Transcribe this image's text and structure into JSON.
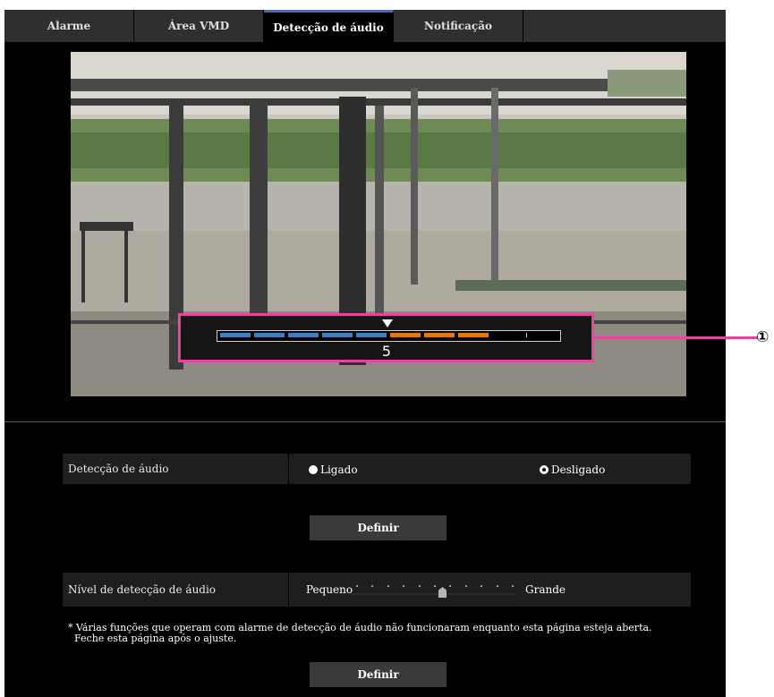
{
  "tabs": [
    {
      "label": "Alarme",
      "active": false
    },
    {
      "label": "Área VMD",
      "active": false
    },
    {
      "label": "Detecção de áudio",
      "active": true
    },
    {
      "label": "Notificação",
      "active": false
    }
  ],
  "meter": {
    "value": "5",
    "segments": [
      "blue",
      "blue",
      "blue",
      "blue",
      "blue",
      "orange",
      "orange",
      "orange",
      "black",
      "black"
    ]
  },
  "callout": "①",
  "detection": {
    "label": "Detecção de áudio",
    "options": [
      {
        "label": "Ligado",
        "checked": false
      },
      {
        "label": "Desligado",
        "checked": true
      }
    ]
  },
  "set_button_1": "Definir",
  "level": {
    "label": "Nível de detecção de áudio",
    "min_label": "Pequeno",
    "max_label": "Grande",
    "ticks": 11,
    "value": 0.55
  },
  "note": "* Várias funções que operam com alarme de detecção de áudio não funcionaram enquanto esta página esteja aberta.\n  Feche esta página após o ajuste.",
  "set_button_2": "Definir",
  "colors": {
    "accent": "#3f6bd8",
    "callout": "#e6479e",
    "blue_seg": "#3f7fc0",
    "orange_seg": "#e07a10"
  }
}
